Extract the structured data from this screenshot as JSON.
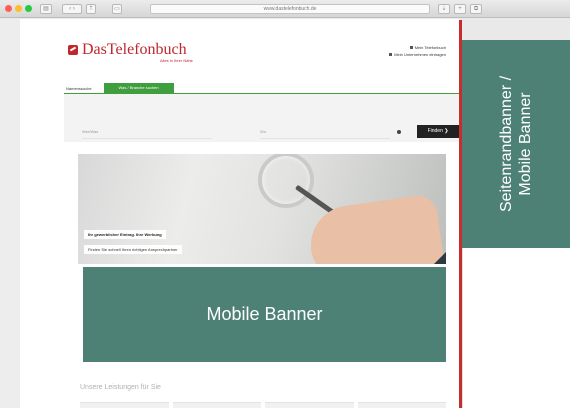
{
  "browser": {
    "address": "www.dastelefonbuch.de",
    "traffic_lights": [
      "#ff5f57",
      "#febc2e",
      "#28c840"
    ]
  },
  "site": {
    "logo_text": "DasTelefonbuch",
    "logo_tagline": "Alles in Ihrer Nähe",
    "top_links": [
      "Mein Telefonbuch",
      "Mein Unternehmen eintragen"
    ]
  },
  "search": {
    "tab_active": "Namenssuche",
    "tab_other": "Was / Branche suchen",
    "field_what": "Wer/Was",
    "field_where": "Wo",
    "button": "Finden ❯"
  },
  "hero": {
    "caption_title": "Ihr gewerblicher Eintrag. Ihre Werbung",
    "caption_text": "Finden Sie schnell Ihren richtigen Ansprechpartner"
  },
  "mobile_banner": {
    "label": "Mobile Banner"
  },
  "services": {
    "heading": "Unsere Leistungen für Sie"
  },
  "side_banner": {
    "line1": "Seitenrandbanner /",
    "line2": "Mobile Banner"
  },
  "colors": {
    "banner": "#4e8176",
    "brand_red": "#c0272d",
    "brand_green": "#3f9e3d"
  }
}
